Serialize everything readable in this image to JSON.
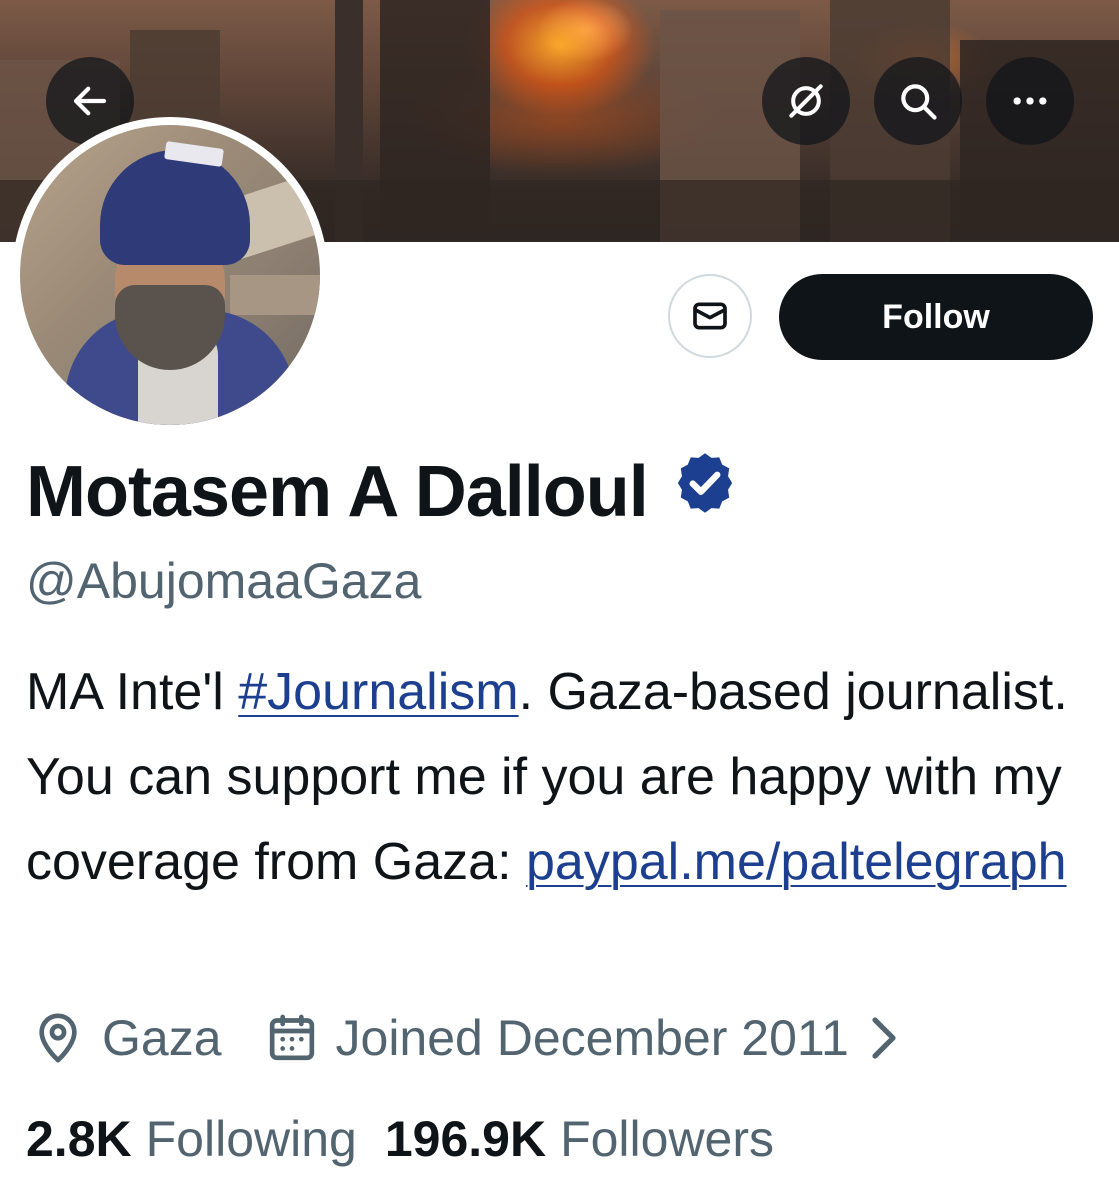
{
  "banner": {
    "back_icon": "arrow-left-icon",
    "actions": [
      "no-notifications-icon",
      "search-icon",
      "more-icon"
    ]
  },
  "profile": {
    "name": "Motasem A Dalloul",
    "handle": "@AbujomaaGaza",
    "verified": true,
    "bio": {
      "part1": "MA Inte'l ",
      "hashtag": "#Journalism",
      "part2": ". Gaza-based journalist. You can support me if you are happy with my coverage from Gaza: ",
      "link": "paypal.me/paltelegraph"
    },
    "location": "Gaza",
    "joined": "Joined December 2011",
    "following_count": "2.8K",
    "following_label": "Following",
    "followers_count": "196.9K",
    "followers_label": "Followers"
  },
  "actions": {
    "message_icon": "envelope-icon",
    "follow_label": "Follow"
  },
  "colors": {
    "primary_text": "#0f1419",
    "secondary_text": "#536471",
    "link": "#1d3f8f",
    "verified": "#1d3f8f",
    "follow_bg": "#0f1419"
  }
}
